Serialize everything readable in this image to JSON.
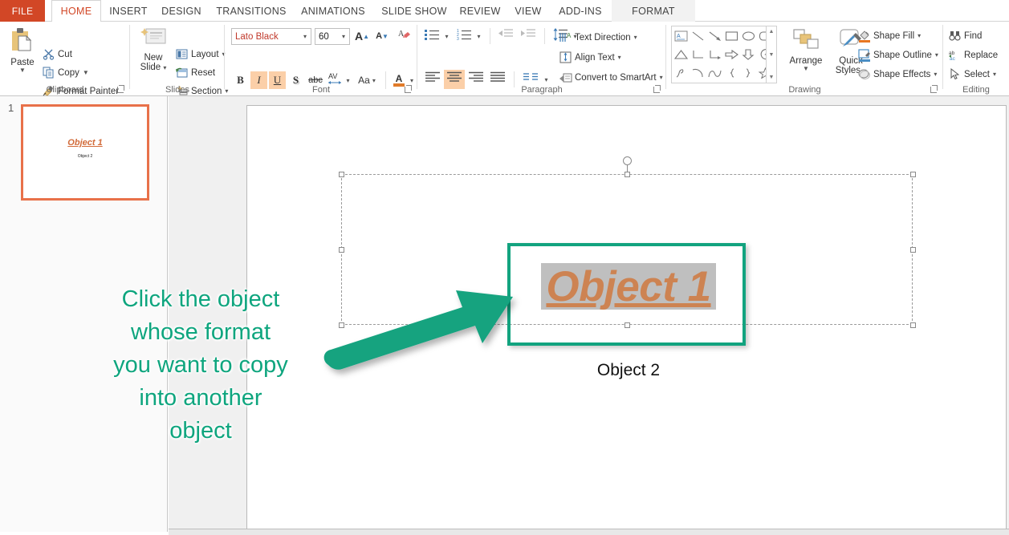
{
  "window": {
    "app": "PowerPoint"
  },
  "tabs": [
    {
      "label": "FILE",
      "state": "file"
    },
    {
      "label": "HOME",
      "state": "active"
    },
    {
      "label": "INSERT",
      "state": "normal"
    },
    {
      "label": "DESIGN",
      "state": "normal"
    },
    {
      "label": "TRANSITIONS",
      "state": "normal"
    },
    {
      "label": "ANIMATIONS",
      "state": "normal"
    },
    {
      "label": "SLIDE SHOW",
      "state": "normal"
    },
    {
      "label": "REVIEW",
      "state": "normal"
    },
    {
      "label": "VIEW",
      "state": "normal"
    },
    {
      "label": "ADD-INS",
      "state": "normal"
    },
    {
      "label": "FORMAT",
      "state": "contextual"
    }
  ],
  "ribbon": {
    "clipboard": {
      "group_label": "Clipboard",
      "paste_label": "Paste",
      "cut_label": "Cut",
      "copy_label": "Copy",
      "format_painter_label": "Format Painter"
    },
    "slides": {
      "group_label": "Slides",
      "new_slide_line1": "New",
      "new_slide_line2": "Slide",
      "layout_label": "Layout",
      "reset_label": "Reset",
      "section_label": "Section"
    },
    "font": {
      "group_label": "Font",
      "font_name": "Lato Black",
      "font_size": "60",
      "bold_label": "B",
      "italic_label": "I",
      "underline_label": "U",
      "shadow_label": "S",
      "strikethrough_label": "abc",
      "character_spacing_label": "AV",
      "change_case_label": "Aa",
      "font_color_label": "A",
      "grow_font_label": "A",
      "shrink_font_label": "A",
      "italic_active": true,
      "underline_active": true
    },
    "paragraph": {
      "group_label": "Paragraph",
      "text_direction_label": "Text Direction",
      "align_text_label": "Align Text",
      "convert_smartart_label": "Convert to SmartArt",
      "center_active": true
    },
    "drawing": {
      "group_label": "Drawing",
      "arrange_label": "Arrange",
      "quick_styles_line1": "Quick",
      "quick_styles_line2": "Styles",
      "shape_fill_label": "Shape Fill",
      "shape_outline_label": "Shape Outline",
      "shape_effects_label": "Shape Effects"
    },
    "editing": {
      "group_label": "Editing",
      "find_label": "Find",
      "replace_label": "Replace",
      "select_label": "Select"
    }
  },
  "slide_panel": {
    "slide_number": "1",
    "thumb_object1": "Object 1",
    "thumb_object2": "Object 2"
  },
  "slide": {
    "object1_text": "Object 1",
    "object2_text": "Object 2",
    "object1_selected": true
  },
  "annotation": {
    "instruction": "Click the object\nwhose format\nyou want to copy\ninto another\nobject",
    "color": "#0ea57e",
    "arrow": "arrow-up-right",
    "highlight_color": "#12a37f"
  },
  "colors": {
    "accent_orange": "#d24726",
    "teal": "#0ea57e",
    "object1_text_color": "#cd8352",
    "selection_highlight": "#bfbfbf",
    "thumb_border": "#e8714a"
  }
}
